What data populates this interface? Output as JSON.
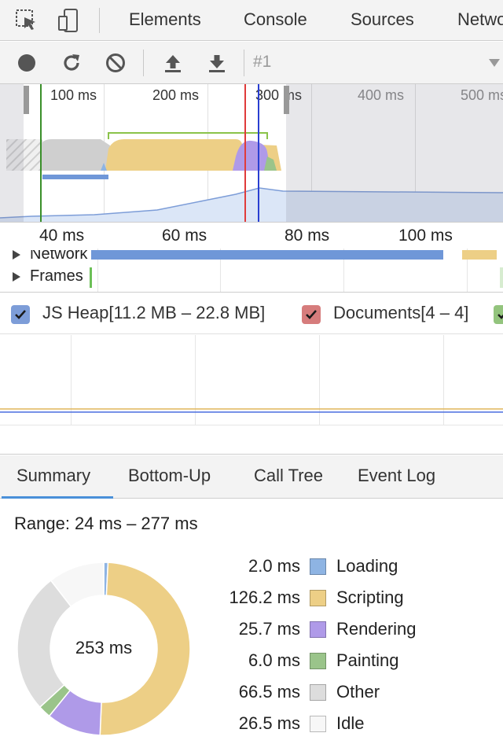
{
  "tabs": [
    "Elements",
    "Console",
    "Sources",
    "Network"
  ],
  "toolbar": {
    "recording_label": "#1",
    "icons": [
      "record-icon",
      "reload-icon",
      "clear-icon",
      "load-profile-icon",
      "save-profile-icon"
    ]
  },
  "overview": {
    "ticks": [
      "100 ms",
      "200 ms",
      "300 ms",
      "400 ms",
      "500 ms"
    ]
  },
  "flamechart": {
    "ticks": [
      "40 ms",
      "60 ms",
      "80 ms",
      "100 ms"
    ],
    "tracks": [
      "Network",
      "Frames"
    ]
  },
  "counters": [
    {
      "label": "JS Heap[11.2 MB – 22.8 MB]",
      "checked": true,
      "color": "#7d9dd8"
    },
    {
      "label": "Documents[4 – 4]",
      "checked": true,
      "color": "#d67c7c"
    },
    {
      "label": "",
      "checked": true,
      "color": "#93c47d"
    }
  ],
  "details": {
    "tabs": [
      "Summary",
      "Bottom-Up",
      "Call Tree",
      "Event Log"
    ],
    "active_tab": "Summary"
  },
  "summary": {
    "range": "Range: 24 ms – 277 ms",
    "total": "253 ms",
    "categories": [
      {
        "value": "2.0 ms",
        "name": "Loading",
        "ms": 2.0,
        "color": "#8eb4e3"
      },
      {
        "value": "126.2 ms",
        "name": "Scripting",
        "ms": 126.2,
        "color": "#edcf86"
      },
      {
        "value": "25.7 ms",
        "name": "Rendering",
        "ms": 25.7,
        "color": "#af9ae8"
      },
      {
        "value": "6.0 ms",
        "name": "Painting",
        "ms": 6.0,
        "color": "#9ac48a"
      },
      {
        "value": "66.5 ms",
        "name": "Other",
        "ms": 66.5,
        "color": "#dddddd"
      },
      {
        "value": "26.5 ms",
        "name": "Idle",
        "ms": 26.5,
        "color": "#f7f7f7"
      }
    ]
  },
  "colors": {
    "accent": "#4a90d9",
    "loading": "#8eb4e3",
    "scripting": "#edcf86",
    "rendering": "#af9ae8",
    "painting": "#9ac48a",
    "other": "#dddddd",
    "idle": "#f7f7f7"
  }
}
